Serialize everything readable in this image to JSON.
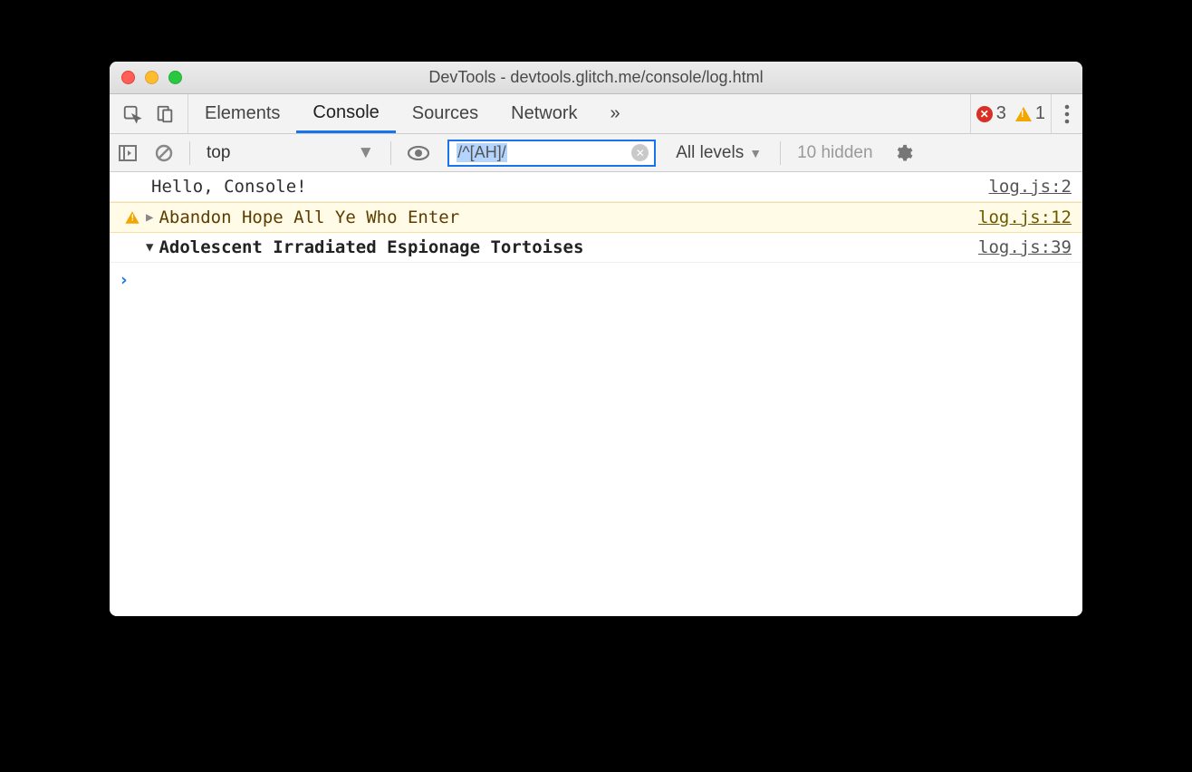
{
  "window": {
    "title": "DevTools - devtools.glitch.me/console/log.html"
  },
  "tabs": {
    "elements": "Elements",
    "console": "Console",
    "sources": "Sources",
    "network": "Network"
  },
  "status": {
    "error_count": "3",
    "warn_count": "1"
  },
  "toolbar": {
    "context": "top",
    "filter_value": "/^[AH]/",
    "levels_label": "All levels",
    "hidden_label": "10 hidden"
  },
  "messages": [
    {
      "kind": "log",
      "disclosure": "",
      "text": "Hello, Console!",
      "source": "log.js:2"
    },
    {
      "kind": "warn",
      "disclosure": "▶",
      "text": "Abandon Hope All Ye Who Enter",
      "source": "log.js:12"
    },
    {
      "kind": "group",
      "disclosure": "▼",
      "text": "Adolescent Irradiated Espionage Tortoises",
      "source": "log.js:39"
    }
  ],
  "prompt": "›"
}
